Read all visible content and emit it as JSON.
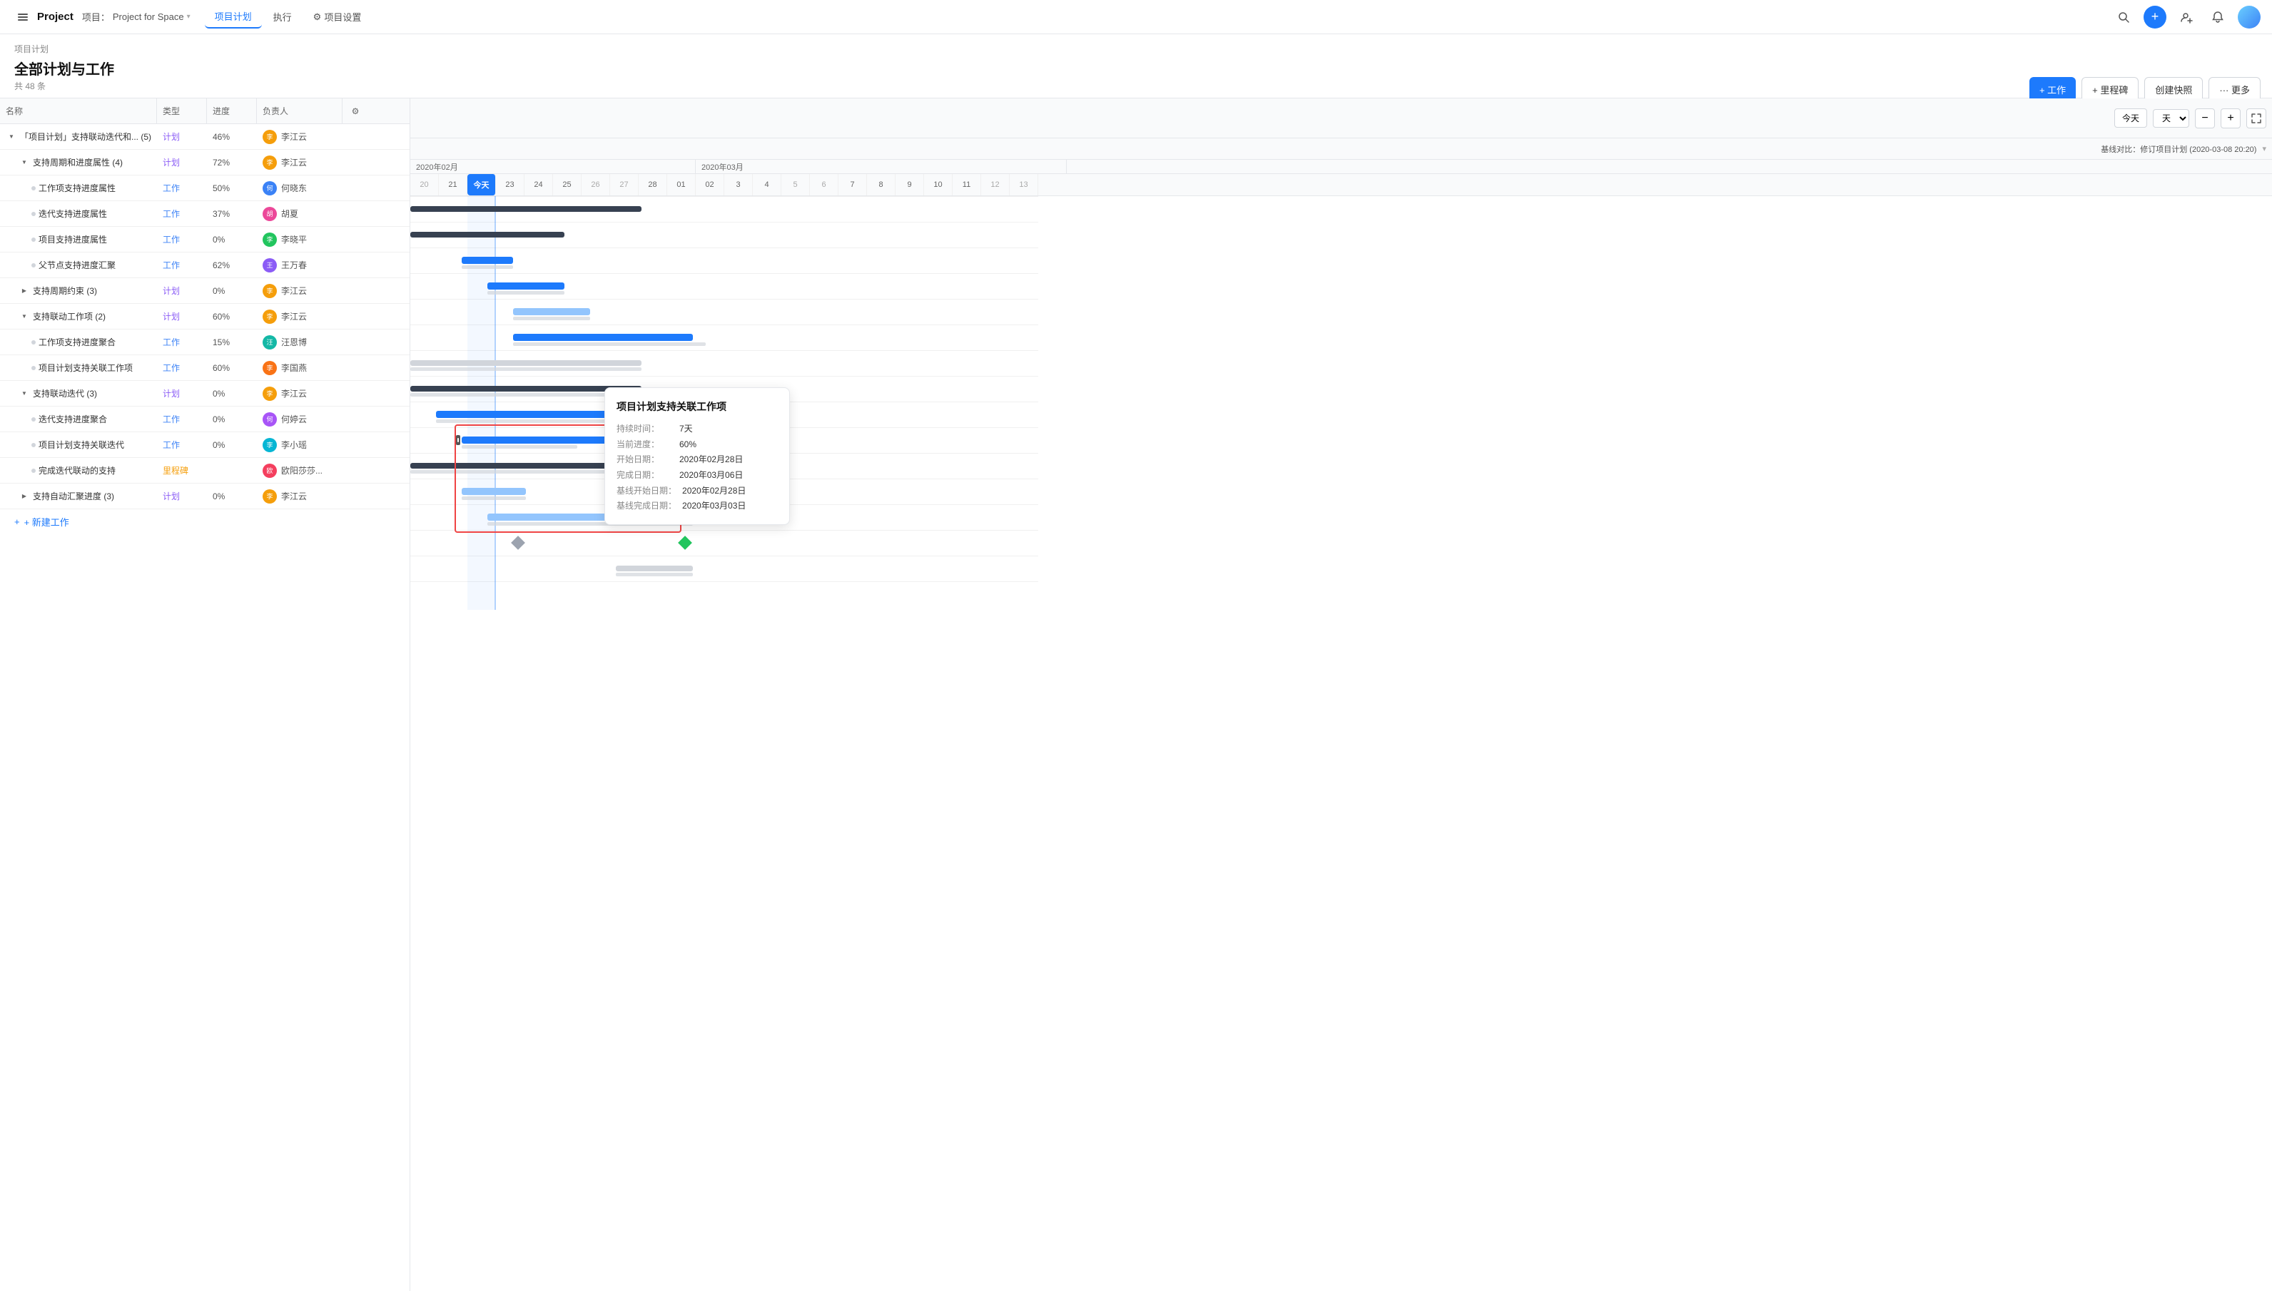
{
  "nav": {
    "app_title": "Project",
    "breadcrumb_label": "项目：",
    "project_name": "Project for Space",
    "tabs": [
      {
        "id": "plan",
        "label": "项目计划",
        "active": true
      },
      {
        "id": "exec",
        "label": "执行",
        "active": false
      },
      {
        "id": "settings",
        "label": "项目设置",
        "active": false
      }
    ],
    "actions": {
      "add_work": "+ 工作",
      "add_milestone": "+ 里程碑",
      "create_quick": "创建快照",
      "more": "··· 更多"
    }
  },
  "page": {
    "breadcrumb": "项目计划",
    "title": "全部计划与工作",
    "count": "共 48 条"
  },
  "table": {
    "headers": {
      "name": "名称",
      "type": "类型",
      "progress": "进度",
      "assignee": "负责人"
    },
    "rows": [
      {
        "id": 1,
        "level": 0,
        "expanded": true,
        "expand_icon": "down",
        "indent": 0,
        "name": "「项目计划」支持联动迭代和... (5)",
        "type": "计划",
        "progress": "46%",
        "assignee": "李江云",
        "avatar_color": "#f59e0b"
      },
      {
        "id": 2,
        "level": 1,
        "expanded": true,
        "expand_icon": "down",
        "indent": 1,
        "name": "支持周期和进度属性 (4)",
        "type": "计划",
        "progress": "72%",
        "assignee": "李江云",
        "avatar_color": "#f59e0b"
      },
      {
        "id": 3,
        "level": 2,
        "expand_icon": "none",
        "indent": 2,
        "name": "工作项支持进度属性",
        "type": "工作",
        "progress": "50%",
        "assignee": "何晓东",
        "avatar_color": "#3b82f6"
      },
      {
        "id": 4,
        "level": 2,
        "expand_icon": "none",
        "indent": 2,
        "name": "迭代支持进度属性",
        "type": "工作",
        "progress": "37%",
        "assignee": "胡夏",
        "avatar_color": "#ec4899"
      },
      {
        "id": 5,
        "level": 2,
        "expand_icon": "none",
        "indent": 2,
        "name": "项目支持进度属性",
        "type": "工作",
        "progress": "0%",
        "assignee": "李晓平",
        "avatar_color": "#22c55e"
      },
      {
        "id": 6,
        "level": 2,
        "expand_icon": "none",
        "indent": 2,
        "name": "父节点支持进度汇聚",
        "type": "工作",
        "progress": "62%",
        "assignee": "王万春",
        "avatar_color": "#8b5cf6"
      },
      {
        "id": 7,
        "level": 1,
        "expanded": false,
        "expand_icon": "right",
        "indent": 1,
        "name": "支持周期约束 (3)",
        "type": "计划",
        "progress": "0%",
        "assignee": "李江云",
        "avatar_color": "#f59e0b"
      },
      {
        "id": 8,
        "level": 1,
        "expanded": true,
        "expand_icon": "down",
        "indent": 1,
        "name": "支持联动工作项 (2)",
        "type": "计划",
        "progress": "60%",
        "assignee": "李江云",
        "avatar_color": "#f59e0b"
      },
      {
        "id": 9,
        "level": 2,
        "expand_icon": "none",
        "indent": 2,
        "name": "工作项支持进度聚合",
        "type": "工作",
        "progress": "15%",
        "assignee": "汪恩博",
        "avatar_color": "#14b8a6"
      },
      {
        "id": 10,
        "level": 2,
        "expand_icon": "none",
        "indent": 2,
        "name": "项目计划支持关联工作项",
        "type": "工作",
        "progress": "60%",
        "assignee": "李国燕",
        "avatar_color": "#f97316"
      },
      {
        "id": 11,
        "level": 1,
        "expanded": true,
        "expand_icon": "down",
        "indent": 1,
        "name": "支持联动迭代 (3)",
        "type": "计划",
        "progress": "0%",
        "assignee": "李江云",
        "avatar_color": "#f59e0b"
      },
      {
        "id": 12,
        "level": 2,
        "expand_icon": "none",
        "indent": 2,
        "name": "迭代支持进度聚合",
        "type": "工作",
        "progress": "0%",
        "assignee": "何婷云",
        "avatar_color": "#a855f7"
      },
      {
        "id": 13,
        "level": 2,
        "expand_icon": "none",
        "indent": 2,
        "name": "项目计划支持关联迭代",
        "type": "工作",
        "progress": "0%",
        "assignee": "李小瑶",
        "avatar_color": "#06b6d4"
      },
      {
        "id": 14,
        "level": 2,
        "expand_icon": "none",
        "indent": 2,
        "name": "完成迭代联动的支持",
        "type": "里程碑",
        "progress": "",
        "assignee": "欧阳莎莎...",
        "avatar_color": "#f43f5e"
      },
      {
        "id": 15,
        "level": 1,
        "expanded": false,
        "expand_icon": "right",
        "indent": 1,
        "name": "支持自动汇聚进度 (3)",
        "type": "计划",
        "progress": "0%",
        "assignee": "李江云",
        "avatar_color": "#f59e0b"
      }
    ]
  },
  "gantt": {
    "today_btn": "今天",
    "view_select": "天",
    "zoom_in": "+",
    "zoom_out": "−",
    "baseline_label": "基线对比：修订项目计划 (2020-03-08 20:20)",
    "months": [
      {
        "label": "2020年02月",
        "cols": 10
      },
      {
        "label": "2020年03月",
        "cols": 13
      }
    ],
    "days": [
      20,
      21,
      "今天",
      23,
      24,
      25,
      26,
      27,
      28,
      "01",
      "02",
      3,
      4,
      5,
      6,
      7,
      8,
      9,
      10,
      11,
      12,
      13
    ],
    "today_col_index": 2
  },
  "tooltip": {
    "title": "项目计划支持关联工作项",
    "rows": [
      {
        "label": "持续时间：",
        "value": "7天"
      },
      {
        "label": "当前进度：",
        "value": "60%"
      },
      {
        "label": "开始日期：",
        "value": "2020年02月28日"
      },
      {
        "label": "完成日期：",
        "value": "2020年03月06日"
      },
      {
        "label": "基线开始日期：",
        "value": "2020年02月28日"
      },
      {
        "label": "基线完成日期：",
        "value": "2020年03月03日"
      }
    ]
  },
  "new_work_label": "+ 新建工作",
  "colors": {
    "blue": "#1d7afc",
    "light_blue": "#93c5fd",
    "gray": "#d1d5db",
    "dark": "#374151",
    "green": "#22c55e",
    "red": "#ef4444"
  }
}
